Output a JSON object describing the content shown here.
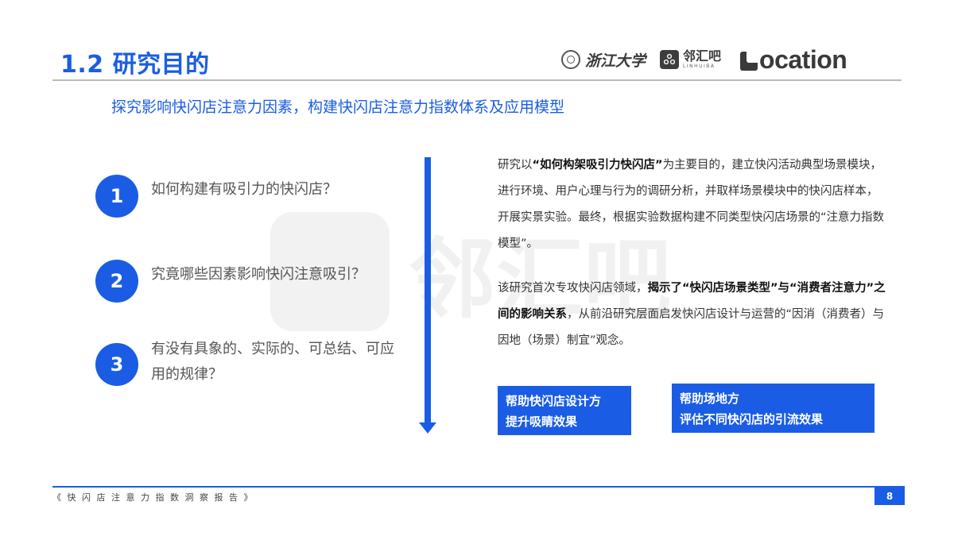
{
  "header": {
    "title": "1.2 研究目的",
    "logos": {
      "zju": "浙江大学",
      "linhuiba_cn": "邻汇吧",
      "linhuiba_en": "LINHUIBA",
      "location": "ocation"
    }
  },
  "subtitle": "探究影响快闪店注意力因素，构建快闪店注意力指数体系及应用模型",
  "watermark": {
    "text": "邻汇吧"
  },
  "questions": [
    {
      "number": "1",
      "text": "如何构建有吸引力的快闪店？"
    },
    {
      "number": "2",
      "text": "究竟哪些因素影响快闪注意吸引？"
    },
    {
      "number": "3",
      "text": "有没有具象的、实际的、可总结、可应用的规律？"
    }
  ],
  "paragraph1": {
    "p1": "研究以",
    "b1": "“如何构架吸引力快闪店”",
    "p2": "为主要目的，建立快闪活动典型场景模块，进行环境、用户心理与行为的调研分析，并取样场景模块中的快闪店样本，开展实景实验。最终，根据实验数据构建不同类型快闪店场景的“注意力指数模型”。"
  },
  "paragraph2": {
    "p1": "该研究首次专攻快闪店领域，",
    "b1": "揭示了“快闪店场景类型”与“消费者注意力”之间的影响关系",
    "p2": "，从前沿研究层面启发快闪店设计与运营的“因消（消费者）与因地（场景）制宜”观念。"
  },
  "tags": [
    {
      "line1": "帮助快闪店设计方",
      "line2": "提升吸睛效果"
    },
    {
      "line1": "帮助场地方",
      "line2": "评估不同快闪店的引流效果"
    }
  ],
  "footer": {
    "text": "《 快 闪 店 注 意 力 指 数 洞 察 报 告 》",
    "page": "8"
  },
  "colors": {
    "accent": "#1a5de4"
  }
}
